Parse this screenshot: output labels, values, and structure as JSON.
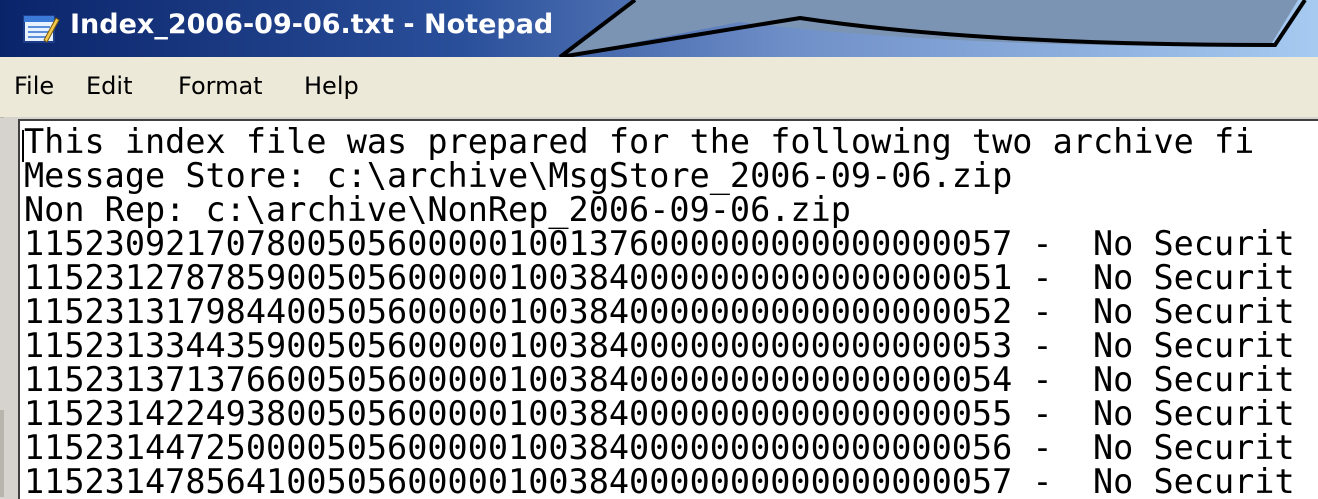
{
  "window": {
    "title": "Index_2006-09-06.txt - Notepad",
    "icon": "notepad-icon"
  },
  "menu": {
    "items": [
      "File",
      "Edit",
      "Format",
      "Help"
    ]
  },
  "document": {
    "lines": [
      "This index file was prepared for the following two archive fi",
      "Message Store: c:\\archive\\MsgStore_2006-09-06.zip",
      "Non Rep: c:\\archive\\NonRep_2006-09-06.zip",
      "1152309217078005056000001001376000000000000000057 -  No Securit",
      "1152312787859005056000001003840000000000000000051 -  No Securit",
      "1152313179844005056000001003840000000000000000052 -  No Securit",
      "1152313344359005056000001003840000000000000000053 -  No Securit",
      "1152313713766005056000001003840000000000000000054 -  No Securit",
      "1152314224938005056000001003840000000000000000055 -  No Securit",
      "1152314472500005056000001003840000000000000000056 -  No Securit",
      "1152314785641005056000001003840000000000000000057 -  No Securit"
    ]
  },
  "colors": {
    "titlebar_start": "#0a246a",
    "titlebar_end": "#a6caf0",
    "callout_fill": "#7b94b4",
    "callout_stroke": "#000000"
  }
}
